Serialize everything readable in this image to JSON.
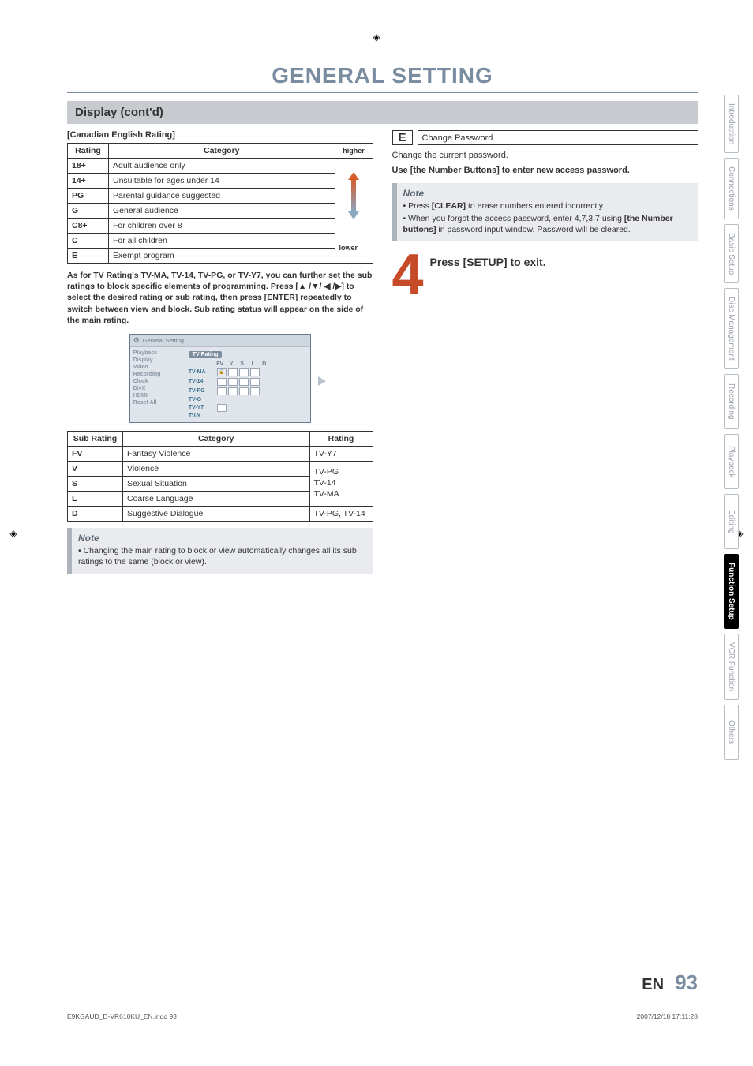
{
  "title": "GENERAL SETTING",
  "section": "Display (cont'd)",
  "left": {
    "subhead": "[Canadian English Rating]",
    "table1": {
      "headers": [
        "Rating",
        "Category",
        ""
      ],
      "rows": [
        {
          "rating": "18+",
          "category": "Adult audience only"
        },
        {
          "rating": "14+",
          "category": "Unsuitable for ages under 14"
        },
        {
          "rating": "PG",
          "category": "Parental guidance suggested"
        },
        {
          "rating": "G",
          "category": "General audience"
        },
        {
          "rating": "C8+",
          "category": "For children over 8"
        },
        {
          "rating": "C",
          "category": "For all children"
        },
        {
          "rating": "E",
          "category": "Exempt program"
        }
      ],
      "arrow_top_label": "higher",
      "arrow_bottom_label": "lower"
    },
    "bold_para": "As for TV Rating's TV-MA, TV-14, TV-PG, or TV-Y7, you can further set the sub ratings to block specific elements of programming. Press [▲ /▼/ ◀ /▶] to select the desired rating or sub rating, then press [ENTER] repeatedly to switch between view and block. Sub rating status will appear on the side of the main rating.",
    "osd": {
      "title": "General Setting",
      "left_items": [
        "Playback",
        "Display",
        "Video",
        "Recording",
        "Clock",
        "DivX",
        "HDMI",
        "Reset All"
      ],
      "tab": "TV Rating",
      "cols": [
        "FV",
        "V",
        "S",
        "L",
        "D"
      ],
      "rows": [
        "TV-MA",
        "TV-14",
        "TV-PG",
        "TV-G",
        "TV-Y7",
        "TV-Y"
      ]
    },
    "table2": {
      "headers": [
        "Sub Rating",
        "Category",
        "Rating"
      ],
      "rows": [
        {
          "sr": "FV",
          "cat": "Fantasy Violence",
          "rating": "TV-Y7"
        },
        {
          "sr": "V",
          "cat": "Violence",
          "rating": ""
        },
        {
          "sr": "S",
          "cat": "Sexual Situation",
          "rating": ""
        },
        {
          "sr": "L",
          "cat": "Coarse Language",
          "rating": ""
        },
        {
          "sr": "D",
          "cat": "Suggestive Dialogue",
          "rating": "TV-PG, TV-14"
        }
      ],
      "stack": [
        "TV-PG",
        "TV-14",
        "TV-MA"
      ]
    },
    "note": {
      "title": "Note",
      "items": [
        "Changing the main rating to block or view automatically changes all its sub ratings to the same (block or view)."
      ]
    }
  },
  "right": {
    "step_letter": "E",
    "step_label": "Change Password",
    "line1": "Change the current password.",
    "line2": "Use [the Number Buttons] to enter new access password.",
    "note": {
      "title": "Note",
      "items": [
        "Press [CLEAR] to erase numbers entered incorrectly.",
        "When you forgot the access password, enter 4,7,3,7 using [the Number buttons] in password input window. Password will be cleared."
      ]
    },
    "big_num": "4",
    "big_text": "Press [SETUP] to exit."
  },
  "tabs": [
    "Introduction",
    "Connections",
    "Basic Setup",
    "Disc Management",
    "Recording",
    "Playback",
    "Editing",
    "Function Setup",
    "VCR Function",
    "Others"
  ],
  "active_tab": "Function Setup",
  "footer": {
    "lang": "EN",
    "page": "93",
    "file": "E9KGAUD_D-VR610KU_EN.indd   93",
    "timestamp": "2007/12/18   17:11:28"
  }
}
